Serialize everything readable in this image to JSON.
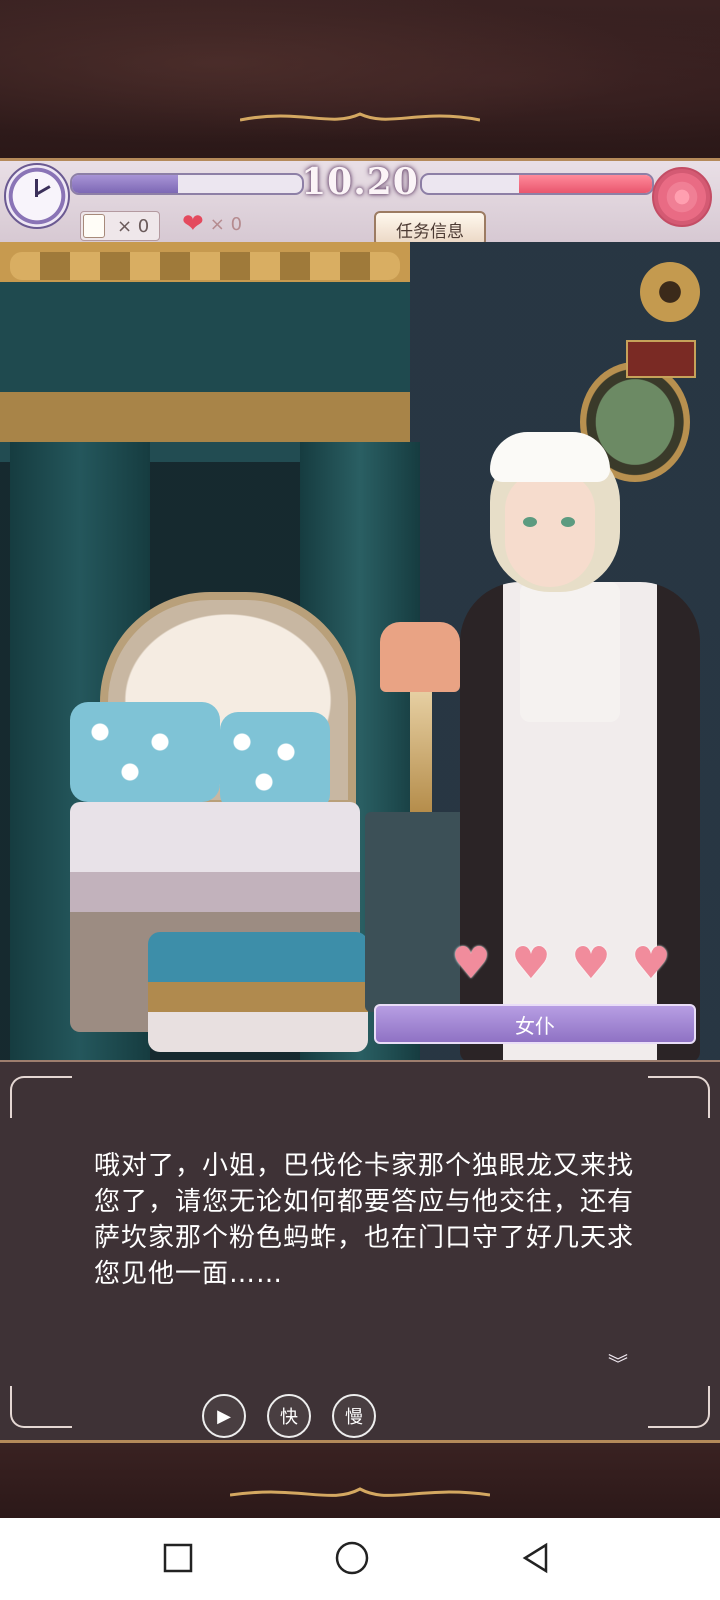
{
  "hud": {
    "date": "10.20",
    "left_bar_fraction": 0.46,
    "right_bar_fraction": 0.58,
    "scroll_count": "× 0",
    "heart_count": "× 0",
    "task_button_label": "任务信息"
  },
  "character": {
    "name": "女仆",
    "affinity_hearts": 4
  },
  "dialogue": {
    "text": "哦对了，小姐，巴伐伦卡家那个独眼龙又来找您了，请您无论如何都要答应与他交往，还有萨坎家那个粉色蚂蚱，也在门口守了好几天求您见他一面……",
    "controls": {
      "auto_label": "▶",
      "fast_label": "快",
      "slow_label": "慢"
    },
    "more_indicator": "︾"
  },
  "icons": {
    "clock": "clock-icon",
    "rose": "rose-icon",
    "scroll": "scroll-icon",
    "heart": "heart-icon",
    "gramophone": "gramophone-icon"
  },
  "colors": {
    "accent_purple": "#8f72c4",
    "heart_pink": "#f18c9c",
    "bar_red": "#e9566e",
    "frame_gold": "#b58a5a"
  }
}
